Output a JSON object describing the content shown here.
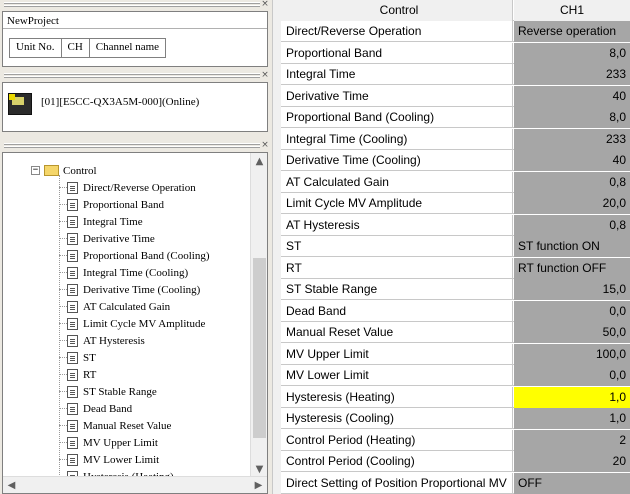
{
  "left_panel": {
    "project_name": "NewProject",
    "unit_columns": [
      "Unit No.",
      "CH",
      "Channel name"
    ],
    "device_label": "[01][E5CC-QX3A5M-000](Online)",
    "tree_folder": "Control",
    "tree_items": [
      "Direct/Reverse Operation",
      "Proportional Band",
      "Integral Time",
      "Derivative Time",
      "Proportional Band (Cooling)",
      "Integral Time (Cooling)",
      "Derivative Time (Cooling)",
      "AT Calculated Gain",
      "Limit Cycle MV Amplitude",
      "AT Hysteresis",
      "ST",
      "RT",
      "ST Stable Range",
      "Dead Band",
      "Manual Reset Value",
      "MV Upper Limit",
      "MV Lower Limit",
      "Hysteresis (Heating)"
    ]
  },
  "table": {
    "header_name": "Control",
    "header_value": "CH1",
    "rows": [
      {
        "name": "Direct/Reverse Operation",
        "value": "Reverse operation",
        "kind": "text"
      },
      {
        "name": "Proportional Band",
        "value": "8,0",
        "kind": "num"
      },
      {
        "name": "Integral Time",
        "value": "233",
        "kind": "num"
      },
      {
        "name": "Derivative Time",
        "value": "40",
        "kind": "num"
      },
      {
        "name": "Proportional Band (Cooling)",
        "value": "8,0",
        "kind": "num"
      },
      {
        "name": "Integral Time (Cooling)",
        "value": "233",
        "kind": "num"
      },
      {
        "name": "Derivative Time (Cooling)",
        "value": "40",
        "kind": "num"
      },
      {
        "name": "AT Calculated Gain",
        "value": "0,8",
        "kind": "num"
      },
      {
        "name": "Limit Cycle MV Amplitude",
        "value": "20,0",
        "kind": "num"
      },
      {
        "name": "AT Hysteresis",
        "value": "0,8",
        "kind": "num"
      },
      {
        "name": "ST",
        "value": "ST function ON",
        "kind": "text"
      },
      {
        "name": "RT",
        "value": "RT function OFF",
        "kind": "text"
      },
      {
        "name": "ST Stable Range",
        "value": "15,0",
        "kind": "num"
      },
      {
        "name": "Dead Band",
        "value": "0,0",
        "kind": "num"
      },
      {
        "name": "Manual Reset Value",
        "value": "50,0",
        "kind": "num"
      },
      {
        "name": "MV Upper Limit",
        "value": "100,0",
        "kind": "num"
      },
      {
        "name": "MV Lower Limit",
        "value": "0,0",
        "kind": "num"
      },
      {
        "name": "Hysteresis (Heating)",
        "value": "1,0",
        "kind": "num",
        "highlight": true
      },
      {
        "name": "Hysteresis (Cooling)",
        "value": "1,0",
        "kind": "num"
      },
      {
        "name": "Control Period (Heating)",
        "value": "2",
        "kind": "num"
      },
      {
        "name": "Control Period (Cooling)",
        "value": "20",
        "kind": "num"
      },
      {
        "name": "Direct Setting of Position Proportional MV",
        "value": "OFF",
        "kind": "text"
      }
    ]
  },
  "colors": {
    "value_cell": "#a6a6a6",
    "highlight": "#ffff00"
  }
}
